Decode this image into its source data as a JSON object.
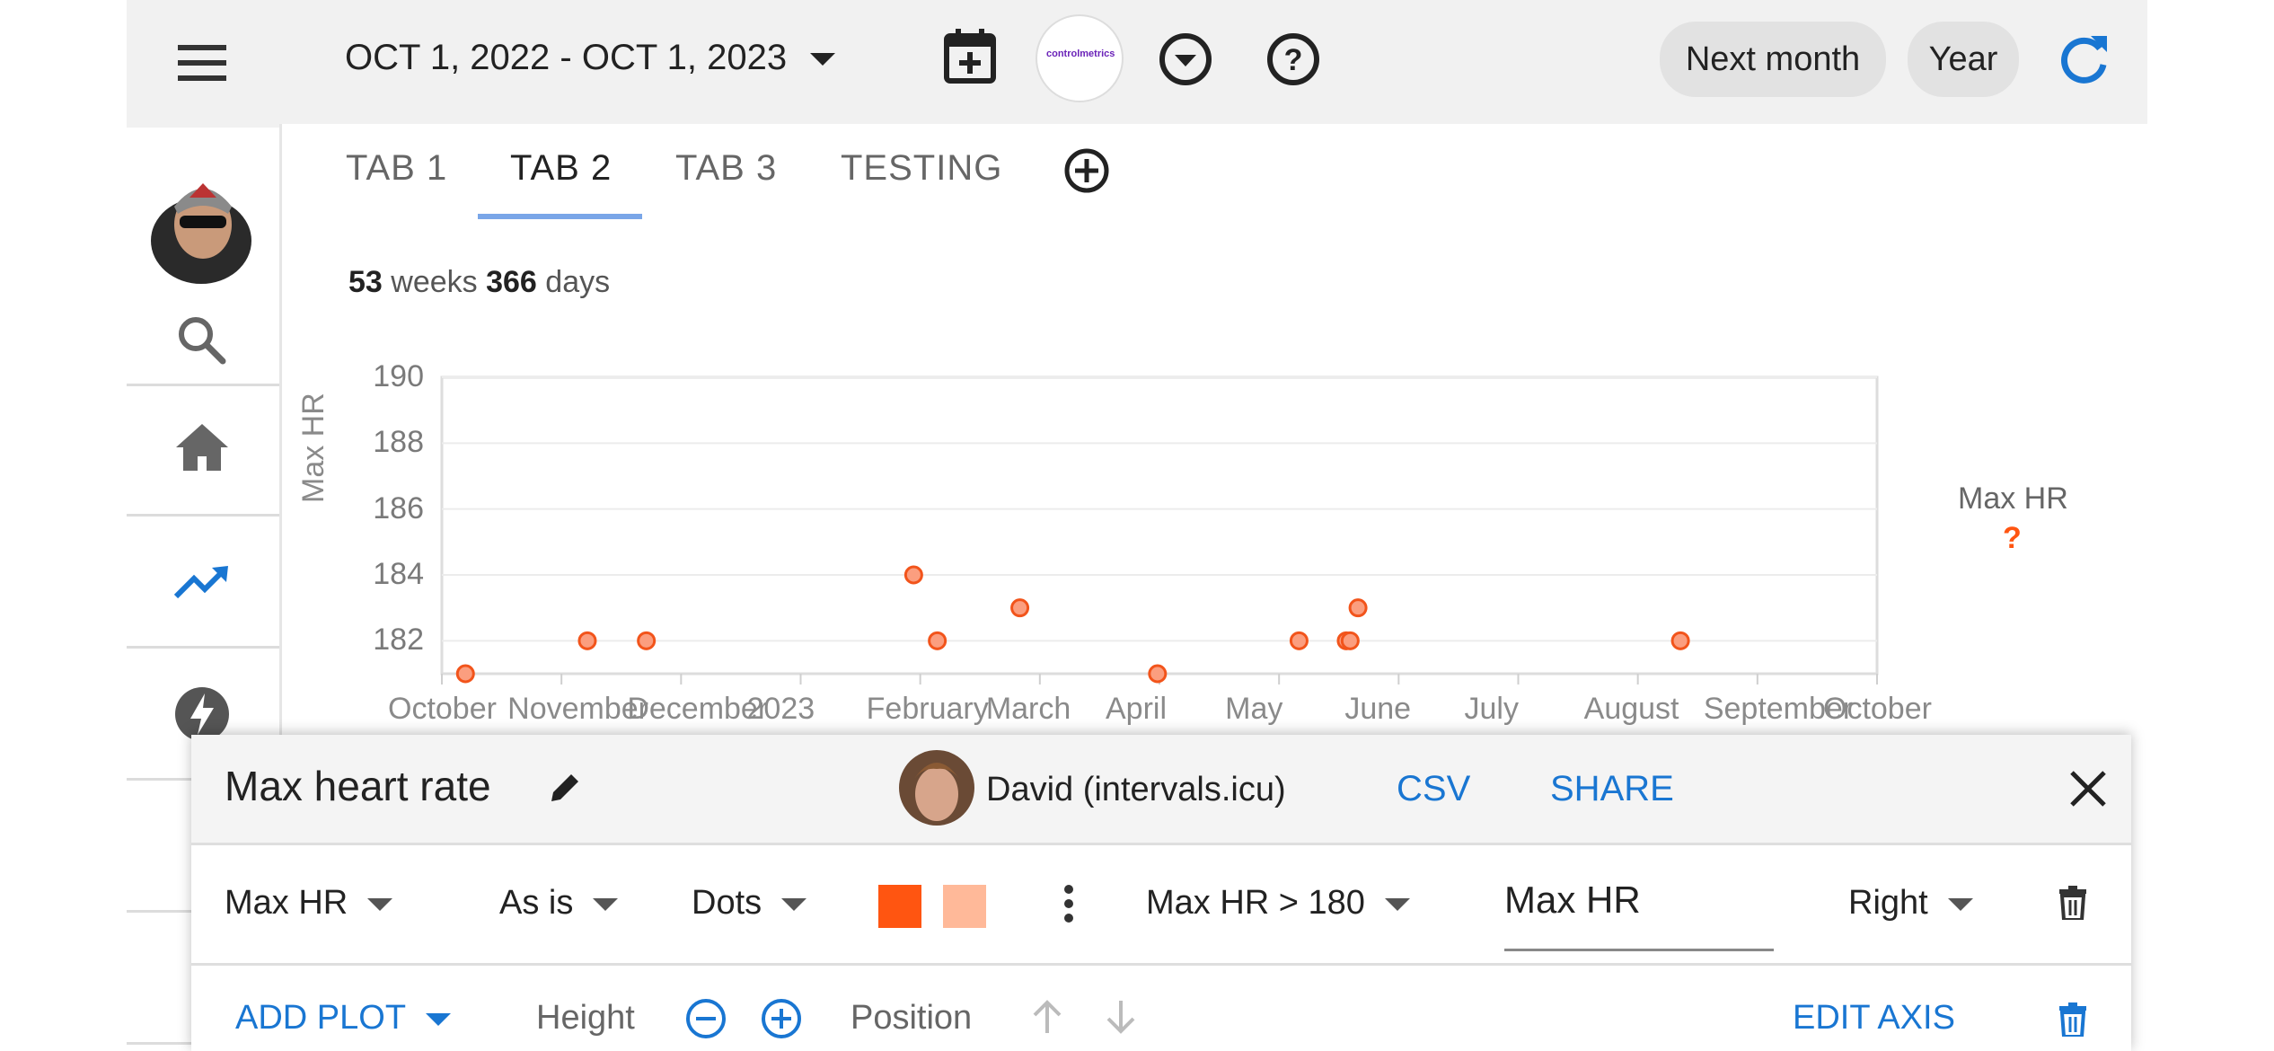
{
  "header": {
    "date_range": "OCT 1, 2022 - OCT 1, 2023",
    "next_month_label": "Next month",
    "year_label": "Year",
    "logo_text": "controlmetrics"
  },
  "tabs": [
    {
      "label": "TAB 1"
    },
    {
      "label": "TAB 2"
    },
    {
      "label": "TAB 3"
    },
    {
      "label": "TESTING"
    }
  ],
  "summary": {
    "weeks_value": "53",
    "weeks_label": "weeks",
    "days_value": "366",
    "days_label": "days"
  },
  "chart_data": {
    "type": "scatter",
    "ylabel": "Max HR",
    "ylim": [
      181,
      190
    ],
    "y_ticks": [
      "190",
      "188",
      "186",
      "184",
      "182"
    ],
    "x_ticks": [
      "October",
      "November",
      "December",
      "2023",
      "February",
      "March",
      "April",
      "May",
      "June",
      "July",
      "August",
      "September",
      "October"
    ],
    "legend": {
      "name": "Max HR",
      "marker": "?"
    },
    "series": [
      {
        "name": "Max HR",
        "points": [
          {
            "x": "2022-10-07",
            "y": 181
          },
          {
            "x": "2022-11-07",
            "y": 182
          },
          {
            "x": "2022-11-22",
            "y": 182
          },
          {
            "x": "2023-01-29",
            "y": 184
          },
          {
            "x": "2023-02-04",
            "y": 182
          },
          {
            "x": "2023-02-25",
            "y": 183
          },
          {
            "x": "2023-04-01",
            "y": 181
          },
          {
            "x": "2023-05-07",
            "y": 182
          },
          {
            "x": "2023-05-19",
            "y": 182
          },
          {
            "x": "2023-05-20",
            "y": 182
          },
          {
            "x": "2023-05-22",
            "y": 183
          },
          {
            "x": "2023-08-12",
            "y": 182
          }
        ]
      }
    ],
    "grid": true,
    "legend_placement": "right"
  },
  "panel": {
    "title": "Max heart rate",
    "user_name": "David (intervals.icu)",
    "csv_label": "CSV",
    "share_label": "SHARE",
    "metric": "Max HR",
    "transform": "As is",
    "style": "Dots",
    "color_primary": "#ff5511",
    "color_secondary": "#ffb999",
    "filter": "Max HR > 180",
    "label_value": "Max HR",
    "axis_side": "Right",
    "add_plot_label": "ADD PLOT",
    "height_label": "Height",
    "position_label": "Position",
    "edit_axis_label": "EDIT AXIS"
  },
  "colors": {
    "accent": "#1976d2",
    "dot_fill": "#fb9e7f",
    "dot_stroke": "#f2541b"
  }
}
